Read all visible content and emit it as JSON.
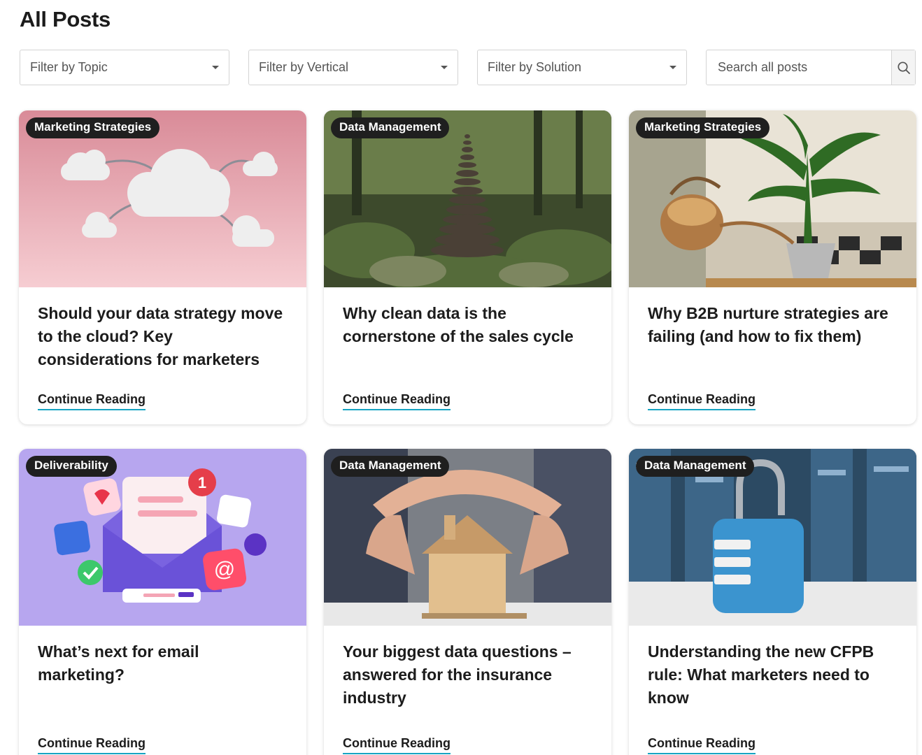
{
  "page": {
    "title": "All Posts"
  },
  "filters": {
    "topic": "Filter by Topic",
    "vertical": "Filter by Vertical",
    "solution": "Filter by Solution",
    "search_placeholder": "Search all posts"
  },
  "icons": {
    "search": "search-icon",
    "dropdown": "caret-down-icon"
  },
  "colors": {
    "accent_underline": "#16a4c3",
    "badge_bg": "#1f1f1f"
  },
  "posts": [
    {
      "category": "Marketing Strategies",
      "title": "Should your data strategy move to the cloud? Key considerations for marketers",
      "cta": "Continue Reading"
    },
    {
      "category": "Data Management",
      "title": "Why clean data is the cornerstone of the sales cycle",
      "cta": "Continue Reading"
    },
    {
      "category": "Marketing Strategies",
      "title": "Why B2B nurture strategies are failing (and how to fix them)",
      "cta": "Continue Reading"
    },
    {
      "category": "Deliverability",
      "title": "What’s next for email marketing?",
      "cta": "Continue Reading"
    },
    {
      "category": "Data Management",
      "title": "Your biggest data questions – answered for the insurance industry",
      "cta": "Continue Reading"
    },
    {
      "category": "Data Management",
      "title": "Understanding the new CFPB rule: What marketers need to know",
      "cta": "Continue Reading"
    }
  ]
}
